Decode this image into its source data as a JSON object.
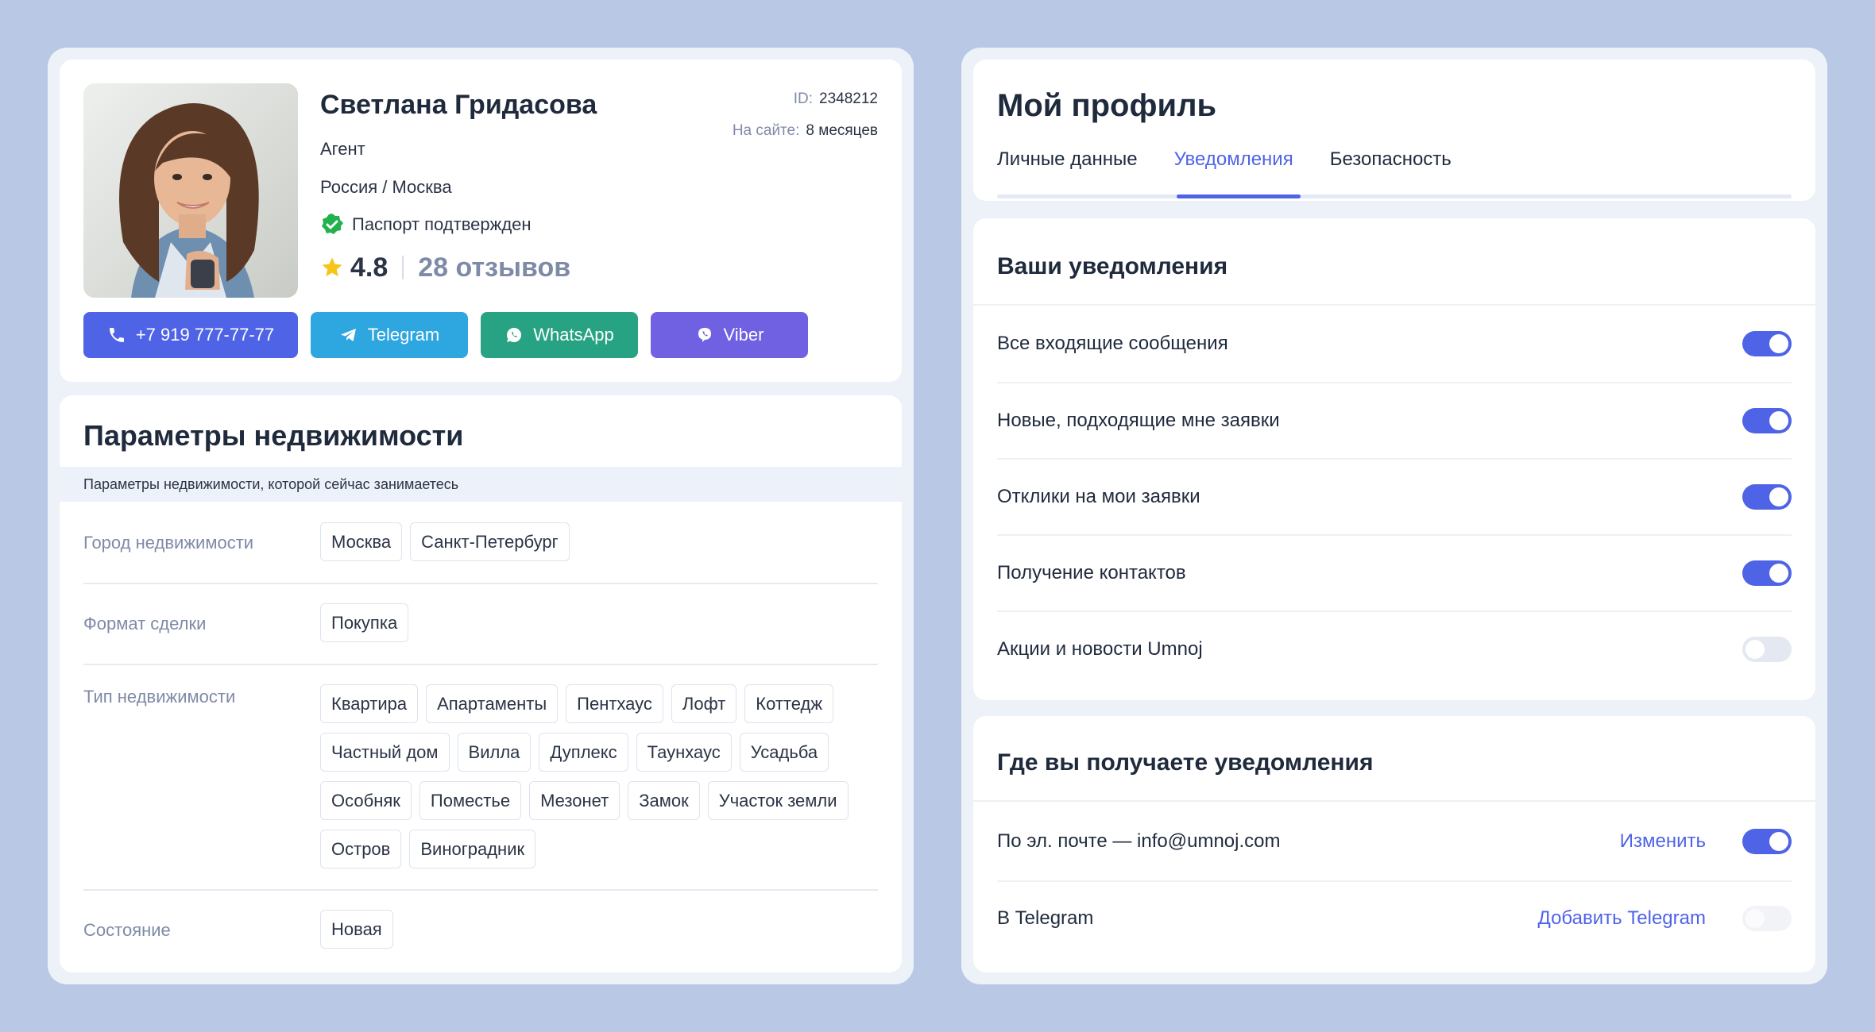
{
  "profile": {
    "name": "Светлана Гридасова",
    "role": "Агент",
    "location": "Россия / Москва",
    "passport": "Паспорт подтвержден",
    "rating": "4.8",
    "reviews": "28 отзывов",
    "id_label": "ID:",
    "id_value": "2348212",
    "onsite_label": "На сайте:",
    "onsite_value": "8 месяцев",
    "contacts": [
      {
        "label": "+7 919 777-77-77",
        "icon": "phone-icon",
        "color": "#4f63e7"
      },
      {
        "label": "Telegram",
        "icon": "telegram-icon",
        "color": "#2ea6e0"
      },
      {
        "label": "WhatsApp",
        "icon": "whatsapp-icon",
        "color": "#27a384"
      },
      {
        "label": "Viber",
        "icon": "viber-icon",
        "color": "#7060e2"
      }
    ]
  },
  "params": {
    "title": "Параметры недвижимости",
    "subtitle": "Параметры недвижимости, которой сейчас занимаетесь",
    "rows": [
      {
        "label": "Город недвижимости",
        "chips": [
          "Москва",
          "Санкт-Петербург"
        ]
      },
      {
        "label": "Формат сделки",
        "chips": [
          "Покупка"
        ]
      },
      {
        "label": "Тип недвижимости",
        "chips": [
          "Квартира",
          "Апартаменты",
          "Пентхаус",
          "Лофт",
          "Коттедж",
          "Частный дом",
          "Вилла",
          "Дуплекс",
          "Таунхаус",
          "Усадьба",
          "Особняк",
          "Поместье",
          "Мезонет",
          "Замок",
          "Участок земли",
          "Остров",
          "Виноградник"
        ]
      },
      {
        "label": "Состояние",
        "chips": [
          "Новая"
        ]
      }
    ]
  },
  "my_profile": {
    "title": "Мой профиль",
    "tabs": [
      "Личные данные",
      "Уведомления",
      "Безопасность"
    ],
    "active_tab": "Уведомления"
  },
  "notifications": {
    "title": "Ваши уведомления",
    "items": [
      {
        "label": "Все входящие сообщения",
        "on": true
      },
      {
        "label": "Новые, подходящие мне заявки",
        "on": true
      },
      {
        "label": "Отклики на мои заявки",
        "on": true
      },
      {
        "label": "Получение контактов",
        "on": true
      },
      {
        "label": "Акции и новости Umnoj",
        "on": false
      }
    ]
  },
  "channels": {
    "title": "Где вы получаете уведомления",
    "items": [
      {
        "label": "По эл. почте — info@umnoj.com",
        "action": "Изменить",
        "on": true
      },
      {
        "label": "В Telegram",
        "action": "Добавить Telegram",
        "on": false
      }
    ]
  },
  "colors": {
    "accent": "#4f63e7",
    "background": "#b9c8e5",
    "verified": "#22b14c",
    "star": "#f5c518"
  }
}
